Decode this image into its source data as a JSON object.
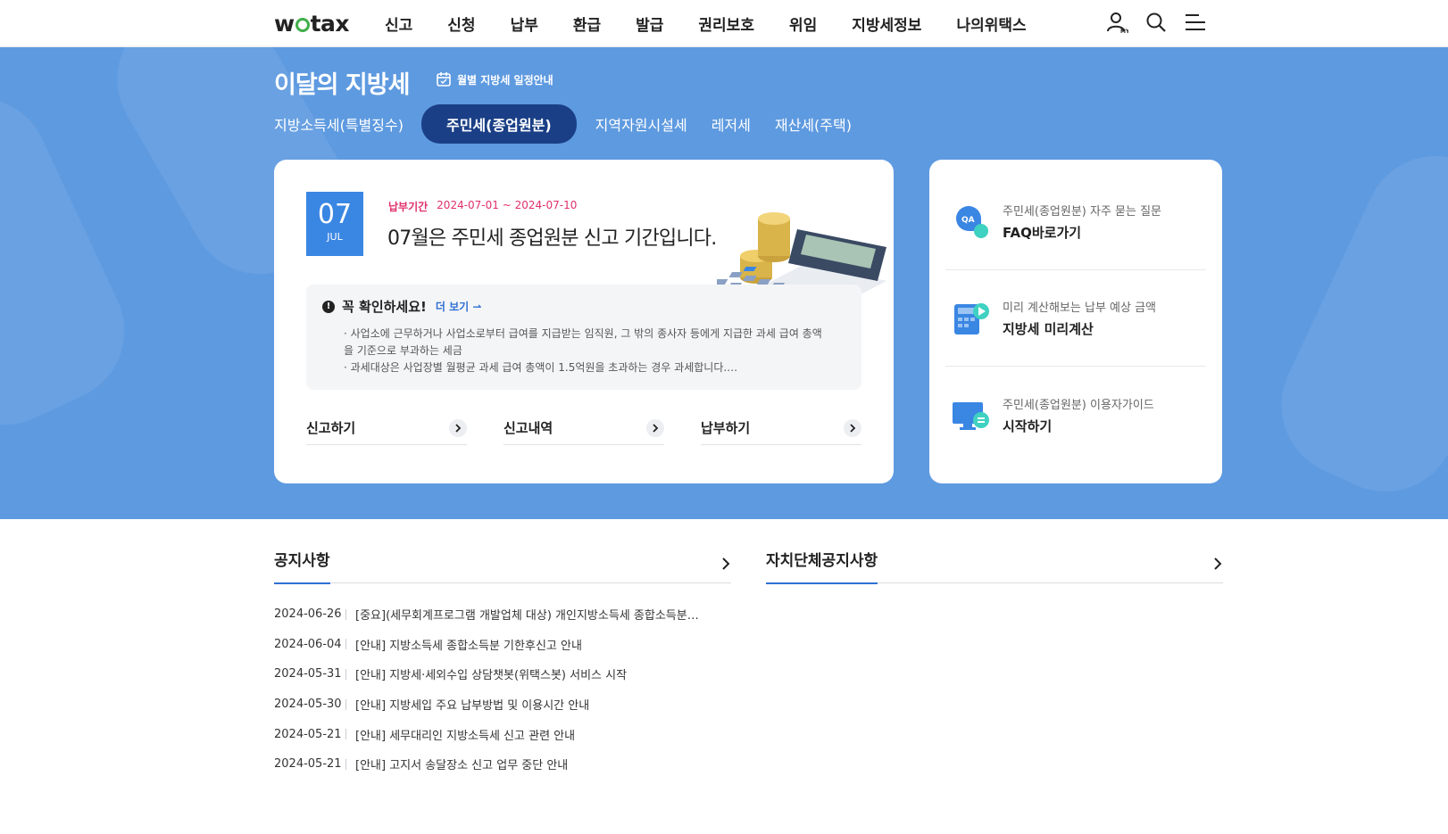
{
  "header": {
    "logo": "wetax",
    "menu": [
      "신고",
      "신청",
      "납부",
      "환급",
      "발급",
      "권리보호",
      "위임",
      "지방세정보",
      "나의위택스"
    ]
  },
  "hero": {
    "title": "이달의 지방세",
    "schedule_link": "월별 지방세 일정안내",
    "tabs": [
      {
        "label": "지방소득세(특별징수)",
        "active": false
      },
      {
        "label": "주민세(종업원분)",
        "active": true
      },
      {
        "label": "지역자원시설세",
        "active": false
      },
      {
        "label": "레저세",
        "active": false
      },
      {
        "label": "재산세(주택)",
        "active": false
      }
    ]
  },
  "main_card": {
    "badge_day": "07",
    "badge_month": "JUL",
    "period_label": "납부기간",
    "period_value": "2024-07-01 ~ 2024-07-10",
    "headline": "07월은 주민세 종업원분 신고 기간입니다.",
    "check_title": "꼭 확인하세요!",
    "more_label": "더 보기",
    "check_lines": [
      "· 사업소에 근무하거나 사업소로부터 급여를 지급받는 임직원, 그 밖의 종사자 등에게 지급한 과세 급여 총액을 기준으로 부과하는 세금",
      "· 과세대상은 사업장별 월평균 과세 급여 총액이 1.5억원을 초과하는 경우 과세합니다.…"
    ],
    "actions": [
      "신고하기",
      "신고내역",
      "납부하기"
    ]
  },
  "side_card": {
    "items": [
      {
        "sub": "주민세(종업원분) 자주 묻는 질문",
        "main": "FAQ바로가기",
        "icon_text": "QA"
      },
      {
        "sub": "미리 계산해보는 납부 예상 금액",
        "main": "지방세 미리계산"
      },
      {
        "sub": "주민세(종업원분) 이용자가이드",
        "main": "시작하기"
      }
    ]
  },
  "notices": {
    "title": "공지사항",
    "rows": [
      {
        "date": "2024-06-26",
        "text": "[중요](세무회계프로그램 개발업체 대상) 개인지방소득세 종합소득분…"
      },
      {
        "date": "2024-06-04",
        "text": "[안내] 지방소득세 종합소득분 기한후신고 안내"
      },
      {
        "date": "2024-05-31",
        "text": "[안내] 지방세·세외수입 상담챗봇(위택스봇) 서비스 시작"
      },
      {
        "date": "2024-05-30",
        "text": "[안내] 지방세입 주요 납부방법 및 이용시간 안내"
      },
      {
        "date": "2024-05-21",
        "text": "[안내] 세무대리인 지방소득세 신고 관련 안내"
      },
      {
        "date": "2024-05-21",
        "text": "[안내] 고지서 송달장소 신고 업무 중단 안내"
      }
    ]
  },
  "local_notices": {
    "title": "자치단체공지사항"
  },
  "colors": {
    "hero_bg": "#5e9ae0",
    "active_tab": "#1a3f86",
    "badge": "#3a86e3",
    "period": "#e0306a",
    "accent": "#2f6fd1"
  }
}
